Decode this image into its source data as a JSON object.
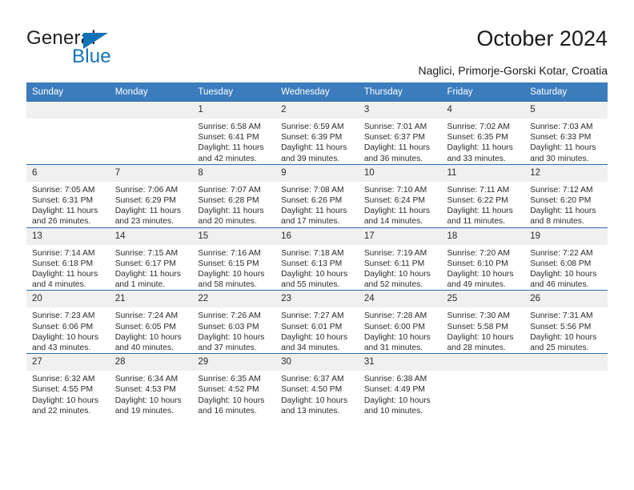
{
  "brand": {
    "name_top": "General",
    "name_bottom": "Blue",
    "color_top": "#231f20",
    "color_bottom": "#1272b8",
    "triangle_color": "#1272b8"
  },
  "header": {
    "title": "October 2024",
    "subtitle": "Naglici, Primorje-Gorski Kotar, Croatia"
  },
  "theme": {
    "header_bg": "#3b7cbd",
    "header_text": "#ffffff",
    "daynum_bg": "#f0f0f0",
    "row_border": "#2b6cad",
    "body_text": "#2b2b2b"
  },
  "weekdays": [
    "Sunday",
    "Monday",
    "Tuesday",
    "Wednesday",
    "Thursday",
    "Friday",
    "Saturday"
  ],
  "labels": {
    "sunrise_prefix": "Sunrise:",
    "sunset_prefix": "Sunset:",
    "daylight_prefix": "Daylight:"
  },
  "weeks": [
    [
      {
        "day": "",
        "sunrise": "",
        "sunset": "",
        "daylight_line1": "",
        "daylight_line2": ""
      },
      {
        "day": "",
        "sunrise": "",
        "sunset": "",
        "daylight_line1": "",
        "daylight_line2": ""
      },
      {
        "day": "1",
        "sunrise": "Sunrise: 6:58 AM",
        "sunset": "Sunset: 6:41 PM",
        "daylight_line1": "Daylight: 11 hours",
        "daylight_line2": "and 42 minutes."
      },
      {
        "day": "2",
        "sunrise": "Sunrise: 6:59 AM",
        "sunset": "Sunset: 6:39 PM",
        "daylight_line1": "Daylight: 11 hours",
        "daylight_line2": "and 39 minutes."
      },
      {
        "day": "3",
        "sunrise": "Sunrise: 7:01 AM",
        "sunset": "Sunset: 6:37 PM",
        "daylight_line1": "Daylight: 11 hours",
        "daylight_line2": "and 36 minutes."
      },
      {
        "day": "4",
        "sunrise": "Sunrise: 7:02 AM",
        "sunset": "Sunset: 6:35 PM",
        "daylight_line1": "Daylight: 11 hours",
        "daylight_line2": "and 33 minutes."
      },
      {
        "day": "5",
        "sunrise": "Sunrise: 7:03 AM",
        "sunset": "Sunset: 6:33 PM",
        "daylight_line1": "Daylight: 11 hours",
        "daylight_line2": "and 30 minutes."
      }
    ],
    [
      {
        "day": "6",
        "sunrise": "Sunrise: 7:05 AM",
        "sunset": "Sunset: 6:31 PM",
        "daylight_line1": "Daylight: 11 hours",
        "daylight_line2": "and 26 minutes."
      },
      {
        "day": "7",
        "sunrise": "Sunrise: 7:06 AM",
        "sunset": "Sunset: 6:29 PM",
        "daylight_line1": "Daylight: 11 hours",
        "daylight_line2": "and 23 minutes."
      },
      {
        "day": "8",
        "sunrise": "Sunrise: 7:07 AM",
        "sunset": "Sunset: 6:28 PM",
        "daylight_line1": "Daylight: 11 hours",
        "daylight_line2": "and 20 minutes."
      },
      {
        "day": "9",
        "sunrise": "Sunrise: 7:08 AM",
        "sunset": "Sunset: 6:26 PM",
        "daylight_line1": "Daylight: 11 hours",
        "daylight_line2": "and 17 minutes."
      },
      {
        "day": "10",
        "sunrise": "Sunrise: 7:10 AM",
        "sunset": "Sunset: 6:24 PM",
        "daylight_line1": "Daylight: 11 hours",
        "daylight_line2": "and 14 minutes."
      },
      {
        "day": "11",
        "sunrise": "Sunrise: 7:11 AM",
        "sunset": "Sunset: 6:22 PM",
        "daylight_line1": "Daylight: 11 hours",
        "daylight_line2": "and 11 minutes."
      },
      {
        "day": "12",
        "sunrise": "Sunrise: 7:12 AM",
        "sunset": "Sunset: 6:20 PM",
        "daylight_line1": "Daylight: 11 hours",
        "daylight_line2": "and 8 minutes."
      }
    ],
    [
      {
        "day": "13",
        "sunrise": "Sunrise: 7:14 AM",
        "sunset": "Sunset: 6:18 PM",
        "daylight_line1": "Daylight: 11 hours",
        "daylight_line2": "and 4 minutes."
      },
      {
        "day": "14",
        "sunrise": "Sunrise: 7:15 AM",
        "sunset": "Sunset: 6:17 PM",
        "daylight_line1": "Daylight: 11 hours",
        "daylight_line2": "and 1 minute."
      },
      {
        "day": "15",
        "sunrise": "Sunrise: 7:16 AM",
        "sunset": "Sunset: 6:15 PM",
        "daylight_line1": "Daylight: 10 hours",
        "daylight_line2": "and 58 minutes."
      },
      {
        "day": "16",
        "sunrise": "Sunrise: 7:18 AM",
        "sunset": "Sunset: 6:13 PM",
        "daylight_line1": "Daylight: 10 hours",
        "daylight_line2": "and 55 minutes."
      },
      {
        "day": "17",
        "sunrise": "Sunrise: 7:19 AM",
        "sunset": "Sunset: 6:11 PM",
        "daylight_line1": "Daylight: 10 hours",
        "daylight_line2": "and 52 minutes."
      },
      {
        "day": "18",
        "sunrise": "Sunrise: 7:20 AM",
        "sunset": "Sunset: 6:10 PM",
        "daylight_line1": "Daylight: 10 hours",
        "daylight_line2": "and 49 minutes."
      },
      {
        "day": "19",
        "sunrise": "Sunrise: 7:22 AM",
        "sunset": "Sunset: 6:08 PM",
        "daylight_line1": "Daylight: 10 hours",
        "daylight_line2": "and 46 minutes."
      }
    ],
    [
      {
        "day": "20",
        "sunrise": "Sunrise: 7:23 AM",
        "sunset": "Sunset: 6:06 PM",
        "daylight_line1": "Daylight: 10 hours",
        "daylight_line2": "and 43 minutes."
      },
      {
        "day": "21",
        "sunrise": "Sunrise: 7:24 AM",
        "sunset": "Sunset: 6:05 PM",
        "daylight_line1": "Daylight: 10 hours",
        "daylight_line2": "and 40 minutes."
      },
      {
        "day": "22",
        "sunrise": "Sunrise: 7:26 AM",
        "sunset": "Sunset: 6:03 PM",
        "daylight_line1": "Daylight: 10 hours",
        "daylight_line2": "and 37 minutes."
      },
      {
        "day": "23",
        "sunrise": "Sunrise: 7:27 AM",
        "sunset": "Sunset: 6:01 PM",
        "daylight_line1": "Daylight: 10 hours",
        "daylight_line2": "and 34 minutes."
      },
      {
        "day": "24",
        "sunrise": "Sunrise: 7:28 AM",
        "sunset": "Sunset: 6:00 PM",
        "daylight_line1": "Daylight: 10 hours",
        "daylight_line2": "and 31 minutes."
      },
      {
        "day": "25",
        "sunrise": "Sunrise: 7:30 AM",
        "sunset": "Sunset: 5:58 PM",
        "daylight_line1": "Daylight: 10 hours",
        "daylight_line2": "and 28 minutes."
      },
      {
        "day": "26",
        "sunrise": "Sunrise: 7:31 AM",
        "sunset": "Sunset: 5:56 PM",
        "daylight_line1": "Daylight: 10 hours",
        "daylight_line2": "and 25 minutes."
      }
    ],
    [
      {
        "day": "27",
        "sunrise": "Sunrise: 6:32 AM",
        "sunset": "Sunset: 4:55 PM",
        "daylight_line1": "Daylight: 10 hours",
        "daylight_line2": "and 22 minutes."
      },
      {
        "day": "28",
        "sunrise": "Sunrise: 6:34 AM",
        "sunset": "Sunset: 4:53 PM",
        "daylight_line1": "Daylight: 10 hours",
        "daylight_line2": "and 19 minutes."
      },
      {
        "day": "29",
        "sunrise": "Sunrise: 6:35 AM",
        "sunset": "Sunset: 4:52 PM",
        "daylight_line1": "Daylight: 10 hours",
        "daylight_line2": "and 16 minutes."
      },
      {
        "day": "30",
        "sunrise": "Sunrise: 6:37 AM",
        "sunset": "Sunset: 4:50 PM",
        "daylight_line1": "Daylight: 10 hours",
        "daylight_line2": "and 13 minutes."
      },
      {
        "day": "31",
        "sunrise": "Sunrise: 6:38 AM",
        "sunset": "Sunset: 4:49 PM",
        "daylight_line1": "Daylight: 10 hours",
        "daylight_line2": "and 10 minutes."
      },
      {
        "day": "",
        "sunrise": "",
        "sunset": "",
        "daylight_line1": "",
        "daylight_line2": ""
      },
      {
        "day": "",
        "sunrise": "",
        "sunset": "",
        "daylight_line1": "",
        "daylight_line2": ""
      }
    ]
  ]
}
